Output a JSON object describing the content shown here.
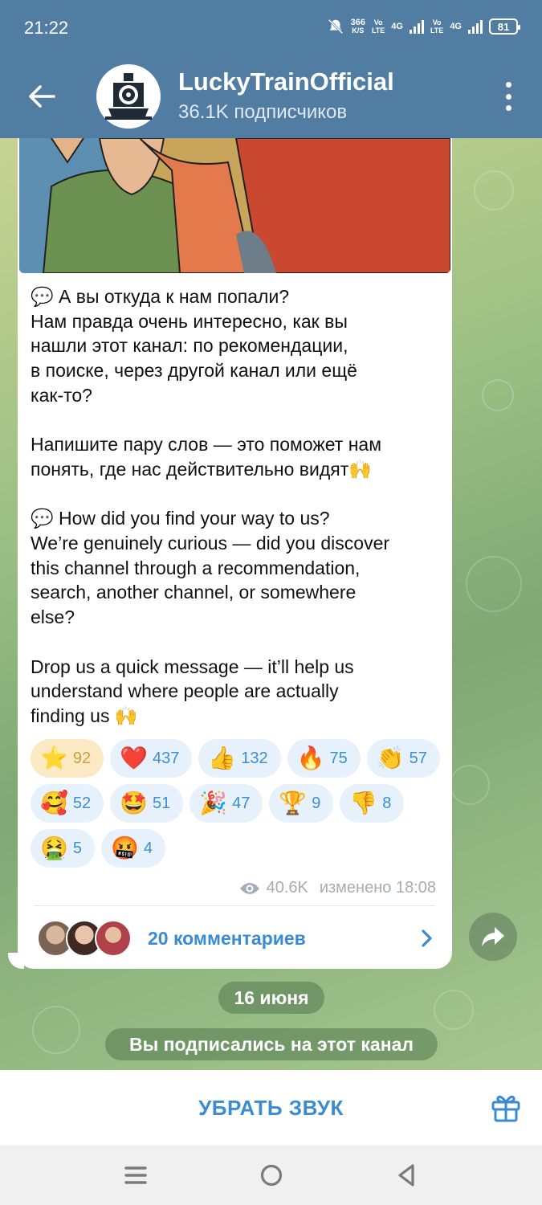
{
  "status_bar": {
    "time": "21:22",
    "net_speed": "366",
    "net_unit": "K/S",
    "sim1": "Vo\nLTE",
    "net1": "4G",
    "sim2": "Vo\nLTE",
    "net2": "4G",
    "battery": "81"
  },
  "header": {
    "title": "LuckyTrainOfficial",
    "subtitle": "36.1K подписчиков"
  },
  "message": {
    "text_ru_1_prefix": "💬",
    "text": "💬 А вы откуда к нам попали?\nНам правда очень интересно, как вы\nнашли этот канал: по рекомендации,\nв поиске, через другой канал или ещё\nкак-то?\n\nНапишите пару слов — это поможет нам\nпонять, где нас действительно видят🙌\n\n💬 How did you find your way to us?\nWe’re genuinely curious — did you discover\nthis channel through a recommendation,\nsearch, another channel, or somewhere\nelse?\n\nDrop us a quick message — it’ll help us\nunderstand where people are actually\nfinding us 🙌",
    "reactions": [
      {
        "emoji": "⭐",
        "count": "92",
        "active": true
      },
      {
        "emoji": "❤️",
        "count": "437"
      },
      {
        "emoji": "👍",
        "count": "132"
      },
      {
        "emoji": "🔥",
        "count": "75"
      },
      {
        "emoji": "👏",
        "count": "57"
      },
      {
        "emoji": "🥰",
        "count": "52"
      },
      {
        "emoji": "🤩",
        "count": "51"
      },
      {
        "emoji": "🎉",
        "count": "47"
      },
      {
        "emoji": "🏆",
        "count": "9"
      },
      {
        "emoji": "👎",
        "count": "8"
      },
      {
        "emoji": "🤮",
        "count": "5"
      },
      {
        "emoji": "🤬",
        "count": "4"
      }
    ],
    "views": "40.6K",
    "edited": "изменено 18:08",
    "comments_label": "20 комментариев"
  },
  "date_pill": "16 июня",
  "service_pill": "Вы подписались на этот канал",
  "bottom": {
    "mute_label": "УБРАТЬ ЗВУК"
  },
  "icons": {
    "back": "arrow-left-icon",
    "menu": "more-vertical-icon",
    "views": "eye-icon",
    "comments_chevron": "chevron-right-icon",
    "share": "share-icon",
    "gift": "gift-icon"
  },
  "colors": {
    "header": "#527da3",
    "link": "#3a8bd3",
    "reaction_bg": "#e6f1fb"
  }
}
